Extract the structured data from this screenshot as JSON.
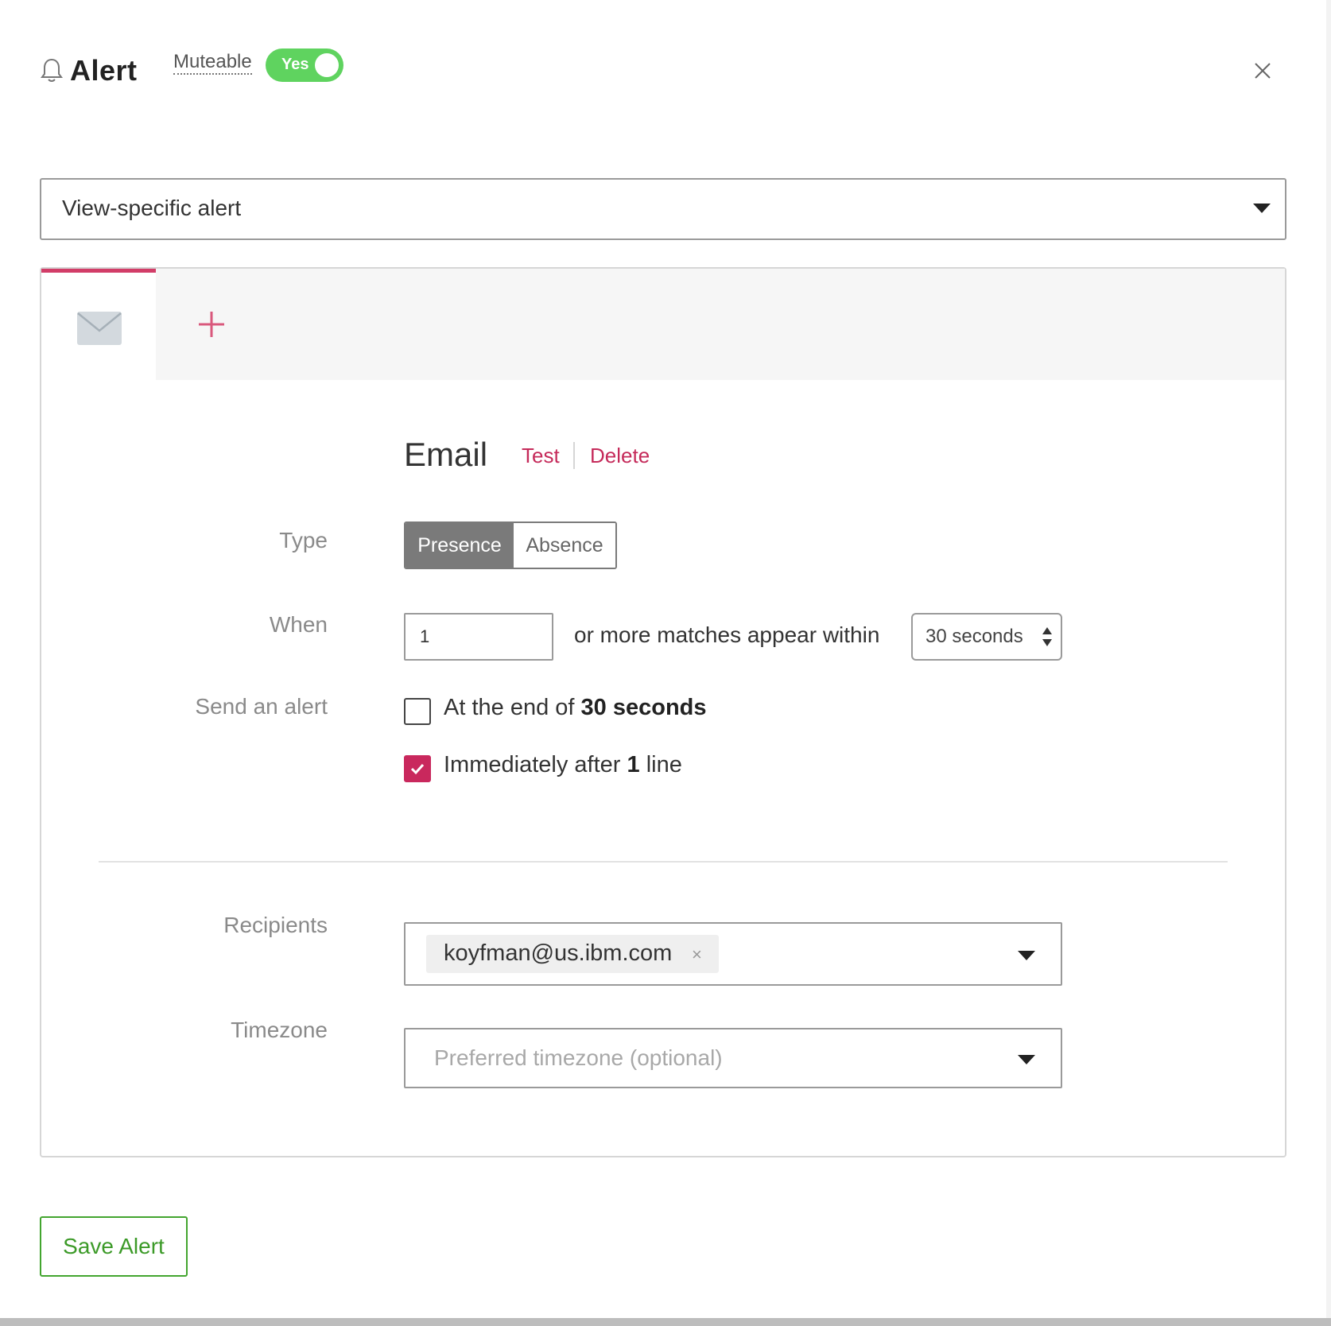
{
  "header": {
    "title": "Alert",
    "muteable_label": "Muteable",
    "toggle_label": "Yes",
    "toggle_on": true
  },
  "view_select": {
    "value": "View-specific alert"
  },
  "channel": {
    "tabs": [
      {
        "icon": "mail-icon",
        "active": true
      }
    ],
    "section_title": "Email",
    "test_link": "Test",
    "delete_link": "Delete"
  },
  "form": {
    "type_label": "Type",
    "type_options": [
      "Presence",
      "Absence"
    ],
    "type_selected": "Presence",
    "when_label": "When",
    "count_value": "1",
    "when_text": "or more matches appear within",
    "interval_value": "30 seconds",
    "send_label": "Send an alert",
    "option_end_prefix": "At the end of",
    "option_end_bold": "30 seconds",
    "option_end_checked": false,
    "option_immediate_prefix": "Immediately after",
    "option_immediate_bold": "1",
    "option_immediate_suffix": "line",
    "option_immediate_checked": true,
    "recipients_label": "Recipients",
    "recipients": [
      "koyfman@us.ibm.com"
    ],
    "chip_remove": "×",
    "timezone_label": "Timezone",
    "timezone_placeholder": "Preferred timezone (optional)"
  },
  "footer": {
    "save_label": "Save Alert"
  },
  "colors": {
    "accent": "#c52a5a",
    "toggle": "#5fd35f",
    "save": "#43a52f"
  }
}
